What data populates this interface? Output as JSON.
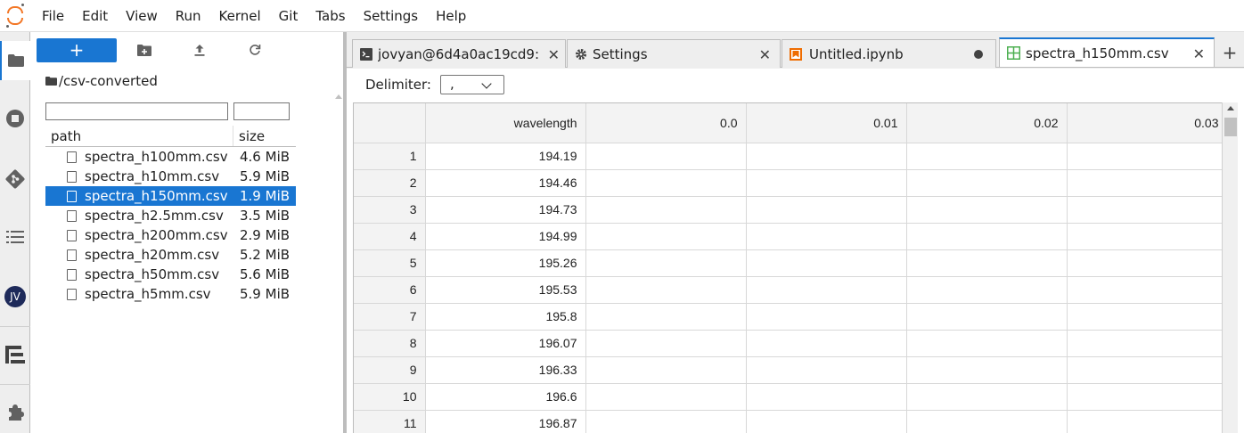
{
  "menu": [
    "File",
    "Edit",
    "View",
    "Run",
    "Kernel",
    "Git",
    "Tabs",
    "Settings",
    "Help"
  ],
  "activity_icons": [
    "folder-icon",
    "running-icon",
    "git-icon",
    "toc-icon",
    "user-icon",
    "property-inspector-icon",
    "extension-icon"
  ],
  "user_initials": "JV",
  "filebrowser": {
    "new_label": "+",
    "breadcrumb": "/csv-converted",
    "columns": {
      "path": "path",
      "size": "size"
    },
    "files": [
      {
        "name": "spectra_h100mm.csv",
        "size": "4.6 MiB"
      },
      {
        "name": "spectra_h10mm.csv",
        "size": "5.9 MiB"
      },
      {
        "name": "spectra_h150mm.csv",
        "size": "1.9 MiB",
        "selected": true
      },
      {
        "name": "spectra_h2.5mm.csv",
        "size": "3.5 MiB"
      },
      {
        "name": "spectra_h200mm.csv",
        "size": "2.9 MiB"
      },
      {
        "name": "spectra_h20mm.csv",
        "size": "5.2 MiB"
      },
      {
        "name": "spectra_h50mm.csv",
        "size": "5.6 MiB"
      },
      {
        "name": "spectra_h5mm.csv",
        "size": "5.9 MiB"
      }
    ]
  },
  "tabs": [
    {
      "label": "jovyan@6d4a0ac19cd9:",
      "icon": "terminal-icon",
      "close": "✕"
    },
    {
      "label": "Settings",
      "icon": "gear-icon",
      "close": "✕"
    },
    {
      "label": "Untitled.ipynb",
      "icon": "notebook-icon",
      "modified": true
    },
    {
      "label": "spectra_h150mm.csv",
      "icon": "spreadsheet-icon",
      "close": "✕",
      "active": true
    }
  ],
  "tab_add": "+",
  "csv": {
    "delimiter_label": "Delimiter:",
    "delimiter_value": ",",
    "headers": [
      "wavelength",
      "0.0",
      "0.01",
      "0.02",
      "0.03"
    ],
    "rows": [
      [
        "1",
        "194.19"
      ],
      [
        "2",
        "194.46"
      ],
      [
        "3",
        "194.73"
      ],
      [
        "4",
        "194.99"
      ],
      [
        "5",
        "195.26"
      ],
      [
        "6",
        "195.53"
      ],
      [
        "7",
        "195.8"
      ],
      [
        "8",
        "196.07"
      ],
      [
        "9",
        "196.33"
      ],
      [
        "10",
        "196.6"
      ],
      [
        "11",
        "196.87"
      ]
    ]
  },
  "colors": {
    "accent": "#1976d2",
    "jupyter_orange": "#f37726",
    "notebook_orange": "#ef6c00",
    "csv_green": "#4caf50"
  }
}
